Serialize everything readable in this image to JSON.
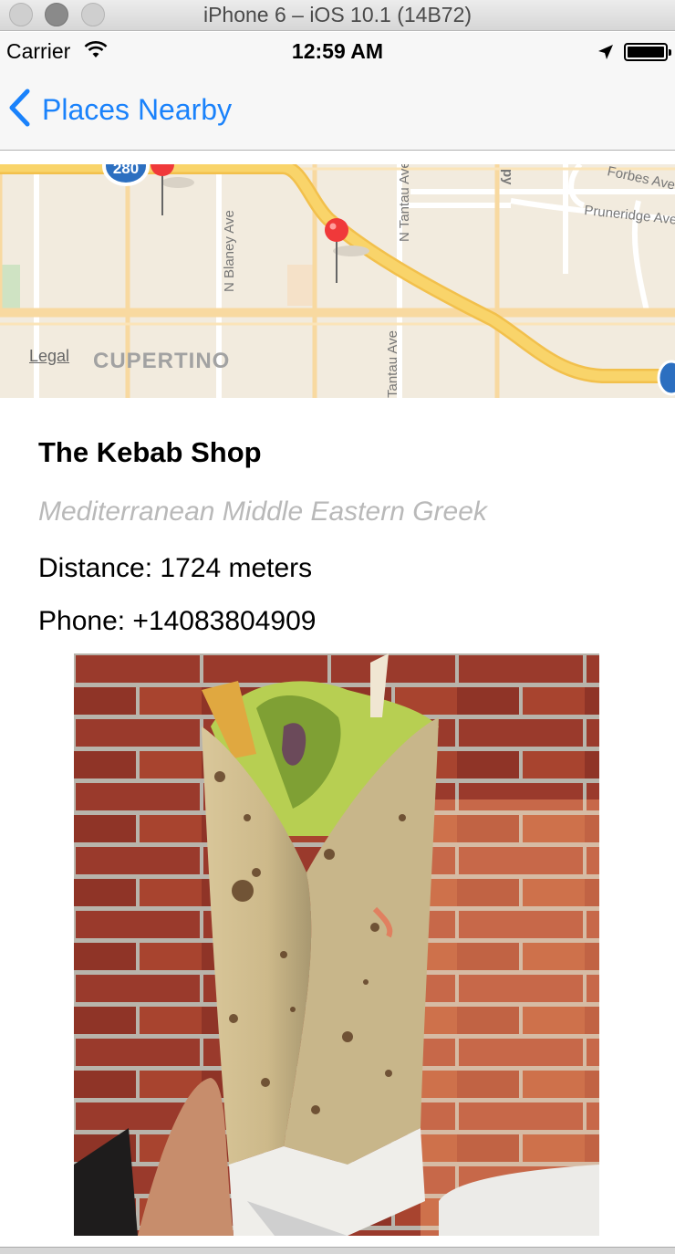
{
  "simulator": {
    "title": "iPhone 6 – iOS 10.1 (14B72)"
  },
  "status_bar": {
    "carrier": "Carrier",
    "time": "12:59 AM",
    "icons": [
      "wifi-icon",
      "location-arrow-icon",
      "battery-icon"
    ],
    "battery_level": 1.0
  },
  "nav": {
    "back_label": "Places Nearby",
    "back_icon": "chevron-left-icon",
    "accent_color": "#1a82fb"
  },
  "map": {
    "legal": "Legal",
    "city_label": "Cupertino",
    "street_labels": [
      "N Blaney Ave",
      "N Tantau Ave",
      "Forbes Ave",
      "Pruneridge Ave",
      "Tantau Ave"
    ],
    "highway_shield": "280",
    "pin_color": "#f0393a"
  },
  "place": {
    "name": "The Kebab Shop",
    "categories": "Mediterranean Middle Eastern Greek",
    "distance": "Distance: 1724 meters",
    "phone": "Phone: +14083804909"
  }
}
